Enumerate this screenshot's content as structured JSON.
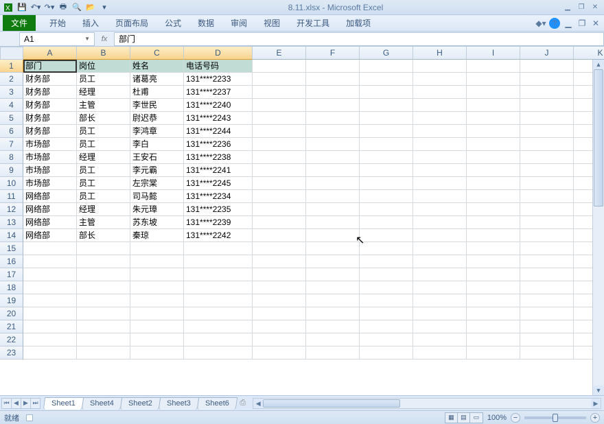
{
  "title": "8.11.xlsx - Microsoft Excel",
  "filetab": "文件",
  "menus": [
    "开始",
    "插入",
    "页面布局",
    "公式",
    "数据",
    "审阅",
    "视图",
    "开发工具",
    "加载项"
  ],
  "namebox": "A1",
  "formula": "部门",
  "columns": [
    "A",
    "B",
    "C",
    "D",
    "E",
    "F",
    "G",
    "H",
    "I",
    "J",
    "K"
  ],
  "headerSelCols": [
    "A",
    "B",
    "C",
    "D"
  ],
  "rowCount": 23,
  "data": {
    "header": [
      "部门",
      "岗位",
      "姓名",
      "电话号码"
    ],
    "rows": [
      [
        "财务部",
        "员工",
        "诸葛亮",
        "131****2233"
      ],
      [
        "财务部",
        "经理",
        "杜甫",
        "131****2237"
      ],
      [
        "财务部",
        "主管",
        "李世民",
        "131****2240"
      ],
      [
        "财务部",
        "部长",
        "尉迟恭",
        "131****2243"
      ],
      [
        "财务部",
        "员工",
        "李鸿章",
        "131****2244"
      ],
      [
        "市场部",
        "员工",
        "李白",
        "131****2236"
      ],
      [
        "市场部",
        "经理",
        "王安石",
        "131****2238"
      ],
      [
        "市场部",
        "员工",
        "李元霸",
        "131****2241"
      ],
      [
        "市场部",
        "员工",
        "左宗棠",
        "131****2245"
      ],
      [
        "网络部",
        "员工",
        "司马懿",
        "131****2234"
      ],
      [
        "网络部",
        "经理",
        "朱元璋",
        "131****2235"
      ],
      [
        "网络部",
        "主管",
        "苏东坡",
        "131****2239"
      ],
      [
        "网络部",
        "部长",
        "秦琼",
        "131****2242"
      ]
    ]
  },
  "sheets": [
    "Sheet1",
    "Sheet4",
    "Sheet2",
    "Sheet3",
    "Sheet6"
  ],
  "activeSheet": "Sheet1",
  "status": "就绪",
  "zoom": "100%"
}
